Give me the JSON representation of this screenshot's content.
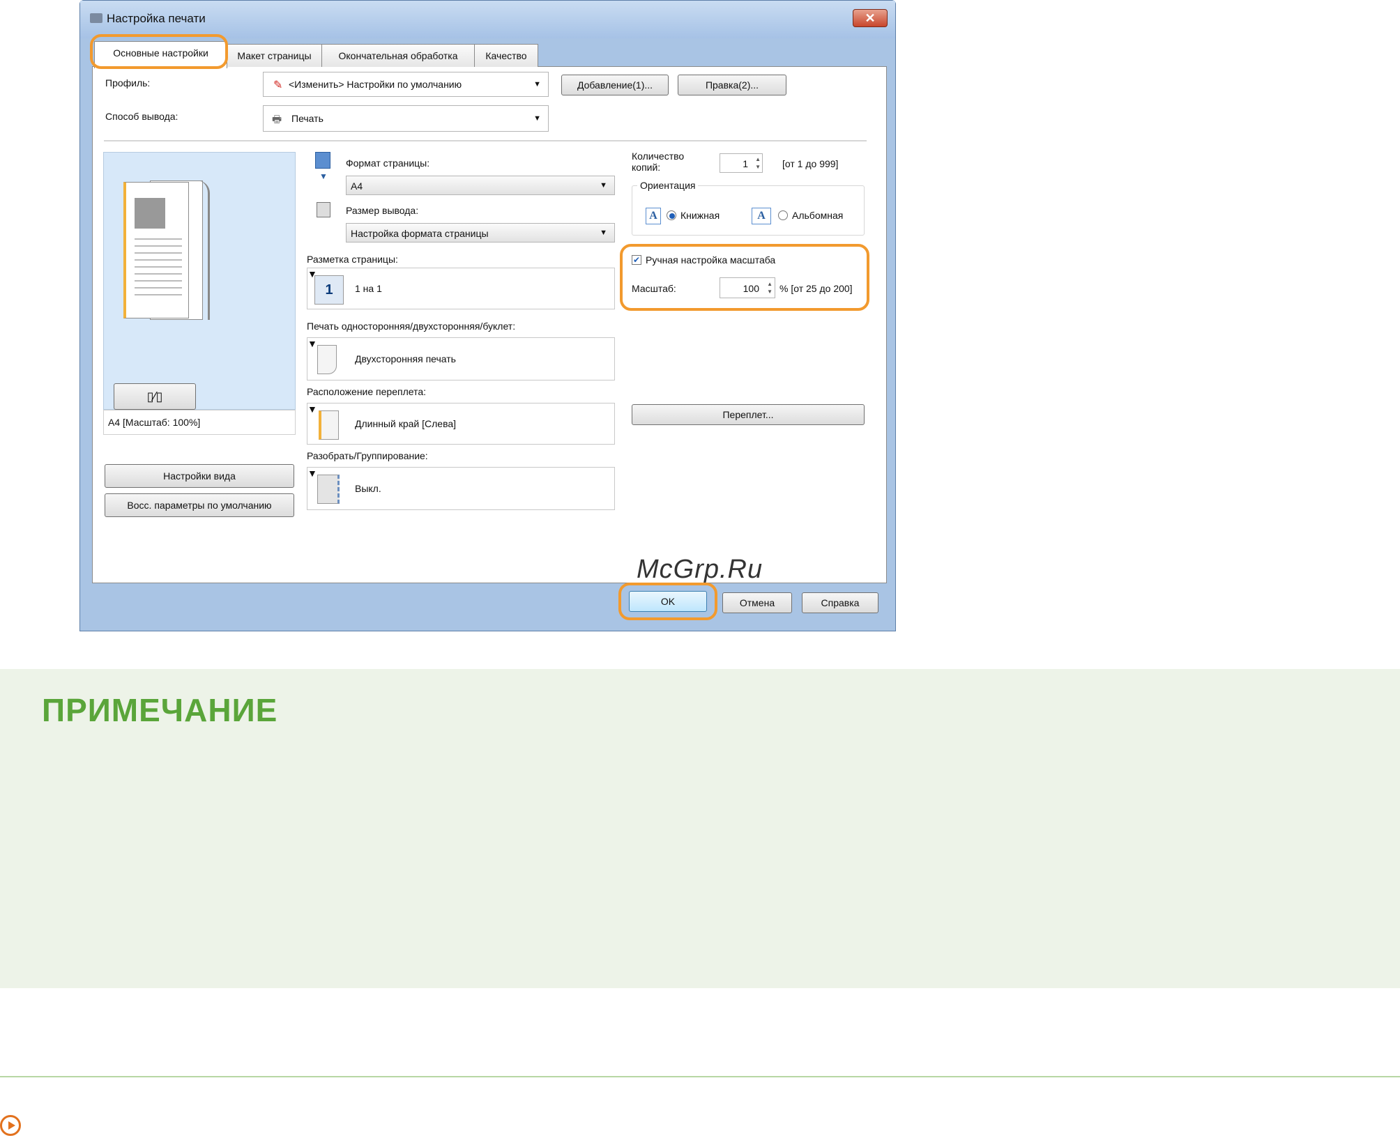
{
  "window": {
    "title": "Настройка печати",
    "close_label": "✕"
  },
  "tabs": [
    {
      "label": "Основные настройки",
      "active": true
    },
    {
      "label": "Макет страницы",
      "active": false
    },
    {
      "label": "Окончательная обработка",
      "active": false
    },
    {
      "label": "Качество",
      "active": false
    }
  ],
  "profile": {
    "label": "Профиль:",
    "value": "<Изменить> Настройки по умолчанию",
    "add_button": "Добавление(1)...",
    "edit_button": "Правка(2)..."
  },
  "output_method": {
    "label": "Способ вывода:",
    "value": "Печать"
  },
  "preview": {
    "caption": "A4 [Масштаб: 100%]",
    "view_settings_button": "Настройки вида",
    "restore_defaults_button": "Восс. параметры по умолчанию"
  },
  "page_size": {
    "label": "Формат страницы:",
    "value": "A4"
  },
  "output_size": {
    "label": "Размер вывода:",
    "value": "Настройка формата страницы"
  },
  "page_layout": {
    "label": "Разметка страницы:",
    "value": "1 на 1",
    "icon_text": "1"
  },
  "duplex": {
    "label": "Печать односторонняя/двухсторонняя/буклет:",
    "value": "Двухсторонняя печать"
  },
  "binding_location": {
    "label": "Расположение переплета:",
    "value": "Длинный край [Слева]"
  },
  "collate": {
    "label": "Разобрать/Группирование:",
    "value": "Выкл."
  },
  "copies": {
    "label_line1": "Количество",
    "label_line2": "копий:",
    "value": "1",
    "range": "[от 1 до 999]"
  },
  "orientation": {
    "legend": "Ориентация",
    "portrait_label": "Книжная",
    "landscape_label": "Альбомная",
    "portrait_selected": true
  },
  "manual_scaling": {
    "label": "Ручная настройка масштаба",
    "checked": true,
    "scale_label": "Масштаб:",
    "scale_value": "100",
    "scale_range": "% [от 25 до 200]"
  },
  "binding_button": "Переплет...",
  "footer": {
    "ok": "OK",
    "cancel": "Отмена",
    "help": "Справка"
  },
  "watermark": "McGrp.Ru",
  "note": {
    "title": "ПРИМЕЧАНИЕ"
  },
  "colors": {
    "highlight": "#f29a2e",
    "note_green": "#5aa53a",
    "note_bg": "#edf3e8"
  }
}
